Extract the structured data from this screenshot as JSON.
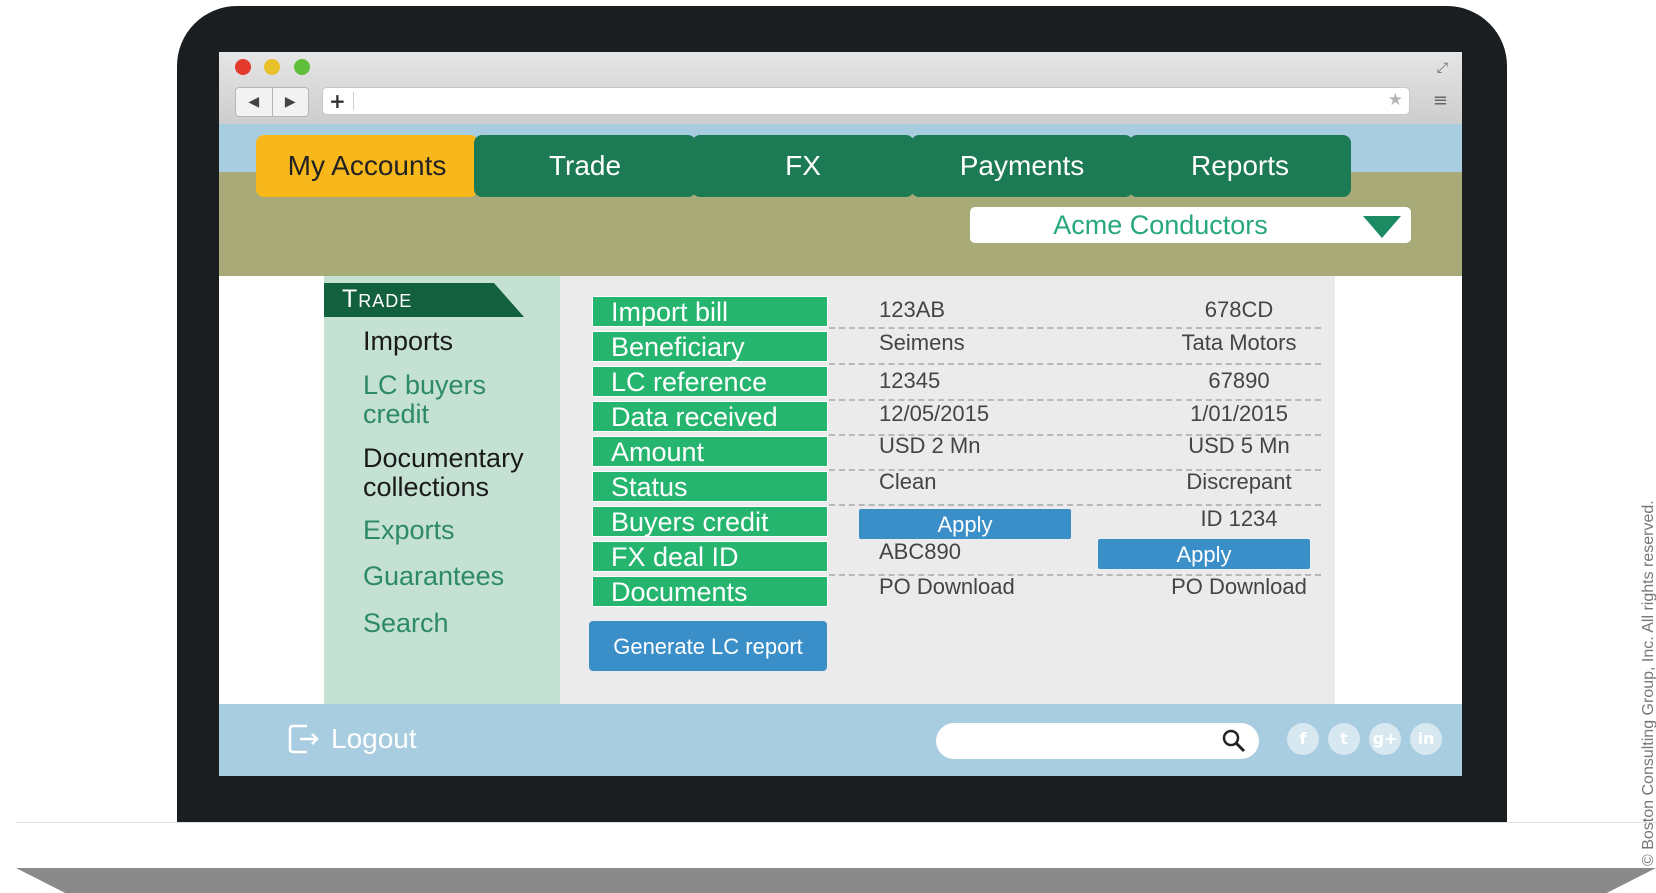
{
  "browser": {
    "back_symbol": "◀",
    "forward_symbol": "▶",
    "plus_symbol": "+",
    "bookmark_symbol": "★",
    "expand_symbol": "⤢",
    "menu_symbol": "≡",
    "url": ""
  },
  "nav": {
    "tabs": [
      {
        "label": "My Accounts",
        "active": true
      },
      {
        "label": "Trade",
        "active": false
      },
      {
        "label": "FX",
        "active": false
      },
      {
        "label": "Payments",
        "active": false
      },
      {
        "label": "Reports",
        "active": false
      }
    ],
    "company_select": "Acme Conductors"
  },
  "sidebar": {
    "header": "Trade",
    "items": [
      "Imports",
      "LC buyers credit",
      "Documentary collections",
      "Exports",
      "Guarantees",
      "Search"
    ]
  },
  "details": {
    "labels": [
      "Import bill",
      "Beneficiary",
      "LC reference",
      "Data received",
      "Amount",
      "Status",
      "Buyers credit",
      "FX deal ID",
      "Documents"
    ],
    "col1": {
      "import_bill": "123AB",
      "beneficiary": "Seimens",
      "lc_reference": "12345",
      "data_received": "12/05/2015",
      "amount": "USD 2 Mn",
      "status": "Clean",
      "buyers_credit_button": "Apply",
      "fx_deal_id": "ABC890",
      "documents": "PO Download"
    },
    "col2": {
      "import_bill": "678CD",
      "beneficiary": "Tata Motors",
      "lc_reference": "67890",
      "data_received": "1/01/2015",
      "amount": "USD 5 Mn",
      "status": "Discrepant",
      "buyers_credit": "ID 1234",
      "fx_deal_button": "Apply",
      "documents": "PO Download"
    },
    "generate_button": "Generate LC report"
  },
  "footer": {
    "logout_label": "Logout",
    "search_placeholder": "",
    "social": [
      "f",
      "t",
      "g+",
      "in"
    ]
  },
  "copyright": "© Boston Consulting Group, Inc. All rights reserved.",
  "colors": {
    "active_tab": "#f8b81b",
    "tab_green": "#1c7a55",
    "label_green": "#26b56e",
    "button_blue": "#3a8fc9",
    "footer_blue": "#a8cce0"
  }
}
